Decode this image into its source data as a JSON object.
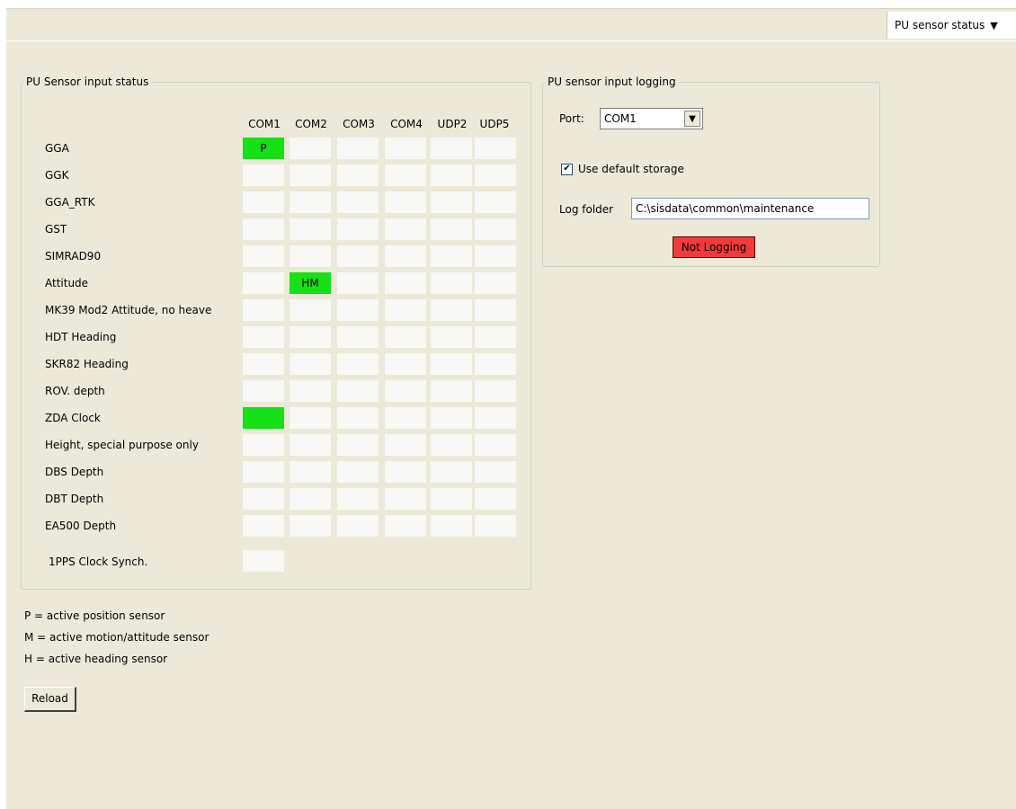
{
  "header": {
    "view_selector": "PU sensor status",
    "view_selector_arrow": "▼"
  },
  "status_panel": {
    "title": "PU Sensor input status",
    "columns": [
      "COM1",
      "COM2",
      "COM3",
      "COM4",
      "UDP2",
      "UDP5"
    ],
    "rows": [
      {
        "label": "GGA",
        "cells": [
          "P",
          "",
          "",
          "",
          "",
          ""
        ],
        "active": [
          true,
          false,
          false,
          false,
          false,
          false
        ]
      },
      {
        "label": "GGK",
        "cells": [
          "",
          "",
          "",
          "",
          "",
          ""
        ],
        "active": [
          false,
          false,
          false,
          false,
          false,
          false
        ]
      },
      {
        "label": "GGA_RTK",
        "cells": [
          "",
          "",
          "",
          "",
          "",
          ""
        ],
        "active": [
          false,
          false,
          false,
          false,
          false,
          false
        ]
      },
      {
        "label": "GST",
        "cells": [
          "",
          "",
          "",
          "",
          "",
          ""
        ],
        "active": [
          false,
          false,
          false,
          false,
          false,
          false
        ]
      },
      {
        "label": "SIMRAD90",
        "cells": [
          "",
          "",
          "",
          "",
          "",
          ""
        ],
        "active": [
          false,
          false,
          false,
          false,
          false,
          false
        ]
      },
      {
        "label": "Attitude",
        "cells": [
          "",
          "HM",
          "",
          "",
          "",
          ""
        ],
        "active": [
          false,
          true,
          false,
          false,
          false,
          false
        ]
      },
      {
        "label": "MK39 Mod2 Attitude, no heave",
        "cells": [
          "",
          "",
          "",
          "",
          "",
          ""
        ],
        "active": [
          false,
          false,
          false,
          false,
          false,
          false
        ]
      },
      {
        "label": "HDT Heading",
        "cells": [
          "",
          "",
          "",
          "",
          "",
          ""
        ],
        "active": [
          false,
          false,
          false,
          false,
          false,
          false
        ]
      },
      {
        "label": "SKR82 Heading",
        "cells": [
          "",
          "",
          "",
          "",
          "",
          ""
        ],
        "active": [
          false,
          false,
          false,
          false,
          false,
          false
        ]
      },
      {
        "label": "ROV. depth",
        "cells": [
          "",
          "",
          "",
          "",
          "",
          ""
        ],
        "active": [
          false,
          false,
          false,
          false,
          false,
          false
        ]
      },
      {
        "label": "ZDA Clock",
        "cells": [
          "",
          "",
          "",
          "",
          "",
          ""
        ],
        "active": [
          true,
          false,
          false,
          false,
          false,
          false
        ]
      },
      {
        "label": "Height, special purpose only",
        "cells": [
          "",
          "",
          "",
          "",
          "",
          ""
        ],
        "active": [
          false,
          false,
          false,
          false,
          false,
          false
        ]
      },
      {
        "label": "DBS Depth",
        "cells": [
          "",
          "",
          "",
          "",
          "",
          ""
        ],
        "active": [
          false,
          false,
          false,
          false,
          false,
          false
        ]
      },
      {
        "label": "DBT Depth",
        "cells": [
          "",
          "",
          "",
          "",
          "",
          ""
        ],
        "active": [
          false,
          false,
          false,
          false,
          false,
          false
        ]
      },
      {
        "label": "EA500 Depth",
        "cells": [
          "",
          "",
          "",
          "",
          "",
          ""
        ],
        "active": [
          false,
          false,
          false,
          false,
          false,
          false
        ]
      }
    ],
    "pps": {
      "label": "1PPS Clock Synch.",
      "value": "",
      "active": false
    }
  },
  "logging_panel": {
    "title": "PU sensor input logging",
    "port_label": "Port:",
    "port_value": "COM1",
    "port_arrow": "▼",
    "use_default_storage_label": "Use default storage",
    "use_default_storage_checked": true,
    "check_mark": "✔",
    "log_folder_label": "Log folder",
    "log_folder_value": "C:\\sisdata\\common\\maintenance",
    "logging_button": "Not Logging"
  },
  "legend": [
    "P = active position sensor",
    "M = active motion/attitude sensor",
    "H = active heading sensor"
  ],
  "reload_button": "Reload",
  "colors": {
    "background": "#ece9d8",
    "active_cell": "#16e016",
    "inactive_cell": "#f8f8f6",
    "not_logging": "#f23a3a"
  }
}
